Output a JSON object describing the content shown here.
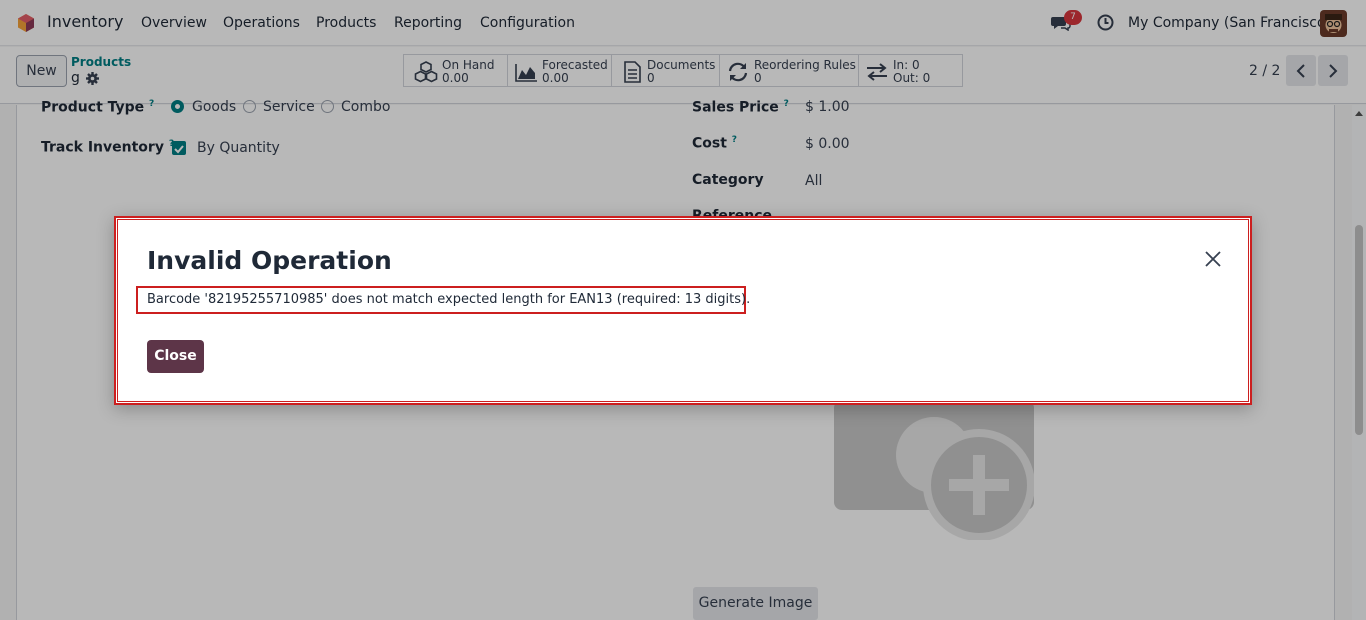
{
  "topbar": {
    "app_name": "Inventory",
    "menu": [
      "Overview",
      "Operations",
      "Products",
      "Reporting",
      "Configuration"
    ],
    "chat_badge": "7",
    "company": "My Company (San Francisco)"
  },
  "control": {
    "new_label": "New",
    "breadcrumb": "Products",
    "record_name": "g",
    "smart_buttons": [
      {
        "label": "On Hand",
        "value": "0.00",
        "icon": "cubes-icon"
      },
      {
        "label": "Forecasted",
        "value": "0.00",
        "icon": "area-chart-icon"
      },
      {
        "label": "Documents",
        "value": "0",
        "icon": "document-icon"
      },
      {
        "label": "Reordering Rules",
        "value": "0",
        "icon": "refresh-icon"
      },
      {
        "label": "In: 0",
        "value": "Out: 0",
        "icon": "exchange-icon"
      }
    ],
    "pager": "2 / 2"
  },
  "form": {
    "product_type_label": "Product Type",
    "product_type_options": [
      "Goods",
      "Service",
      "Combo"
    ],
    "track_inventory_label": "Track Inventory",
    "track_inventory_value": "By Quantity",
    "sales_price_label": "Sales Price",
    "sales_price_value": "$ 1.00",
    "cost_label": "Cost",
    "cost_value": "$ 0.00",
    "category_label": "Category",
    "category_value": "All",
    "reference_label": "Reference",
    "generate_image_label": "Generate Image"
  },
  "dialog": {
    "title": "Invalid Operation",
    "message": "Barcode '82195255710985' does not match expected length for EAN13 (required: 13 digits).",
    "close_label": "Close"
  },
  "colors": {
    "accent": "#017e84",
    "primary_button": "#5d3548",
    "highlight": "#cc1f1f",
    "badge": "#d9363e"
  }
}
